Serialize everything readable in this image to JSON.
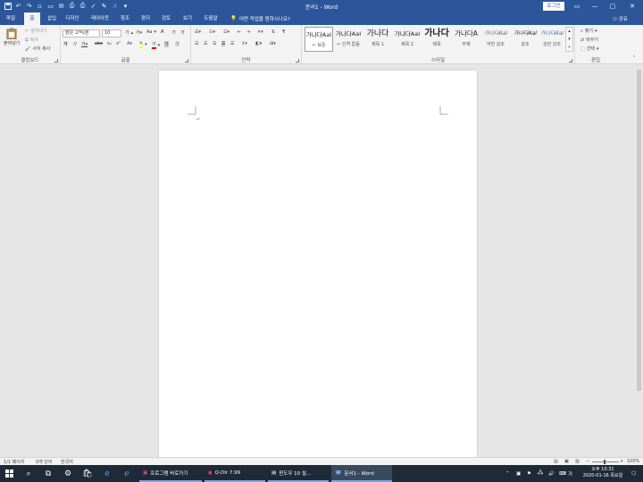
{
  "window": {
    "doc_title": "문서1 - Word",
    "login_label": "로그인"
  },
  "tabs": [
    {
      "label": "파일"
    },
    {
      "label": "홈"
    },
    {
      "label": "삽입"
    },
    {
      "label": "디자인"
    },
    {
      "label": "레이아웃"
    },
    {
      "label": "참조"
    },
    {
      "label": "편지"
    },
    {
      "label": "검토"
    },
    {
      "label": "보기"
    },
    {
      "label": "도움말"
    }
  ],
  "tell_me": "어떤 작업을 원하시나요?",
  "share_label": "공유",
  "clipboard": {
    "paste": "붙여넣기",
    "cut": "잘라내기",
    "copy": "복사",
    "format_painter": "서식 복사",
    "group_label": "클립보드"
  },
  "font": {
    "name": "맑은 고딕(본",
    "size": "10",
    "grow": "가",
    "change_case": "Aa",
    "group_label": "글꼴"
  },
  "paragraph": {
    "group_label": "단락"
  },
  "styles": {
    "items": [
      {
        "preview": "가나다AaI",
        "name": "표준"
      },
      {
        "preview": "가나다AaI",
        "name": "간격 없음"
      },
      {
        "preview": "가나다",
        "name": "제목 1"
      },
      {
        "preview": "가나다AaI",
        "name": "제목 2"
      },
      {
        "preview": "가나다",
        "name": "제목"
      },
      {
        "preview": "가나다A",
        "name": "부제"
      },
      {
        "preview": "가나다AaI",
        "name": "약한 강조"
      },
      {
        "preview": "가나다AaI",
        "name": "강조"
      },
      {
        "preview": "가나다AaI",
        "name": "강한 강조"
      }
    ],
    "group_label": "스타일"
  },
  "editing": {
    "find": "찾기",
    "replace": "바꾸기",
    "select": "선택",
    "group_label": "편집"
  },
  "status": {
    "page": "1/1 페이지",
    "words": "0개 단어",
    "language": "한국어",
    "zoom": "100%"
  },
  "taskbar": {
    "apps": [
      {
        "label": "프로그램 바로가기"
      },
      {
        "label": "Q-Dir 7.99"
      },
      {
        "label": "윈도우 10 설..."
      },
      {
        "label": "문서1 - Word"
      }
    ],
    "ime": "가",
    "time": "오후 10:31",
    "date": "2020-01-16 목요일"
  },
  "colors": {
    "word_blue": "#2b579a",
    "ribbon_bg": "#f3f3f3",
    "taskbar": "#1f2a38"
  }
}
